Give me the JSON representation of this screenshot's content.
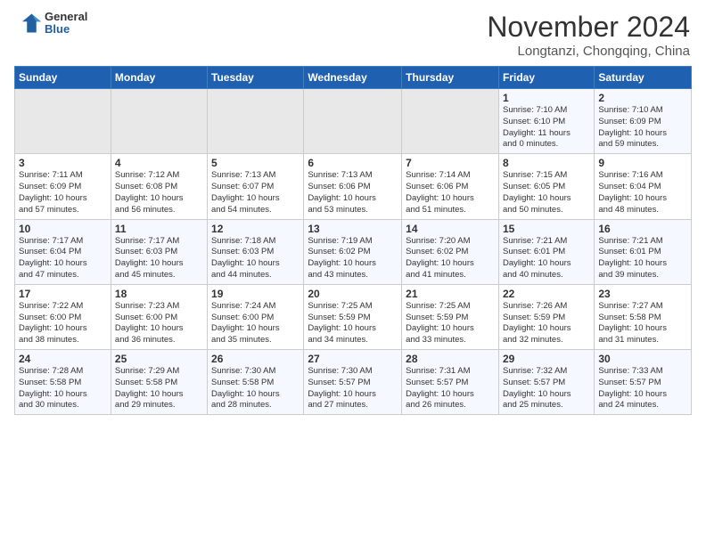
{
  "header": {
    "logo": {
      "general": "General",
      "blue": "Blue"
    },
    "title": "November 2024",
    "location": "Longtanzi, Chongqing, China"
  },
  "calendar": {
    "days_of_week": [
      "Sunday",
      "Monday",
      "Tuesday",
      "Wednesday",
      "Thursday",
      "Friday",
      "Saturday"
    ],
    "weeks": [
      [
        {
          "day": "",
          "info": ""
        },
        {
          "day": "",
          "info": ""
        },
        {
          "day": "",
          "info": ""
        },
        {
          "day": "",
          "info": ""
        },
        {
          "day": "",
          "info": ""
        },
        {
          "day": "1",
          "info": "Sunrise: 7:10 AM\nSunset: 6:10 PM\nDaylight: 11 hours\nand 0 minutes."
        },
        {
          "day": "2",
          "info": "Sunrise: 7:10 AM\nSunset: 6:09 PM\nDaylight: 10 hours\nand 59 minutes."
        }
      ],
      [
        {
          "day": "3",
          "info": "Sunrise: 7:11 AM\nSunset: 6:09 PM\nDaylight: 10 hours\nand 57 minutes."
        },
        {
          "day": "4",
          "info": "Sunrise: 7:12 AM\nSunset: 6:08 PM\nDaylight: 10 hours\nand 56 minutes."
        },
        {
          "day": "5",
          "info": "Sunrise: 7:13 AM\nSunset: 6:07 PM\nDaylight: 10 hours\nand 54 minutes."
        },
        {
          "day": "6",
          "info": "Sunrise: 7:13 AM\nSunset: 6:06 PM\nDaylight: 10 hours\nand 53 minutes."
        },
        {
          "day": "7",
          "info": "Sunrise: 7:14 AM\nSunset: 6:06 PM\nDaylight: 10 hours\nand 51 minutes."
        },
        {
          "day": "8",
          "info": "Sunrise: 7:15 AM\nSunset: 6:05 PM\nDaylight: 10 hours\nand 50 minutes."
        },
        {
          "day": "9",
          "info": "Sunrise: 7:16 AM\nSunset: 6:04 PM\nDaylight: 10 hours\nand 48 minutes."
        }
      ],
      [
        {
          "day": "10",
          "info": "Sunrise: 7:17 AM\nSunset: 6:04 PM\nDaylight: 10 hours\nand 47 minutes."
        },
        {
          "day": "11",
          "info": "Sunrise: 7:17 AM\nSunset: 6:03 PM\nDaylight: 10 hours\nand 45 minutes."
        },
        {
          "day": "12",
          "info": "Sunrise: 7:18 AM\nSunset: 6:03 PM\nDaylight: 10 hours\nand 44 minutes."
        },
        {
          "day": "13",
          "info": "Sunrise: 7:19 AM\nSunset: 6:02 PM\nDaylight: 10 hours\nand 43 minutes."
        },
        {
          "day": "14",
          "info": "Sunrise: 7:20 AM\nSunset: 6:02 PM\nDaylight: 10 hours\nand 41 minutes."
        },
        {
          "day": "15",
          "info": "Sunrise: 7:21 AM\nSunset: 6:01 PM\nDaylight: 10 hours\nand 40 minutes."
        },
        {
          "day": "16",
          "info": "Sunrise: 7:21 AM\nSunset: 6:01 PM\nDaylight: 10 hours\nand 39 minutes."
        }
      ],
      [
        {
          "day": "17",
          "info": "Sunrise: 7:22 AM\nSunset: 6:00 PM\nDaylight: 10 hours\nand 38 minutes."
        },
        {
          "day": "18",
          "info": "Sunrise: 7:23 AM\nSunset: 6:00 PM\nDaylight: 10 hours\nand 36 minutes."
        },
        {
          "day": "19",
          "info": "Sunrise: 7:24 AM\nSunset: 6:00 PM\nDaylight: 10 hours\nand 35 minutes."
        },
        {
          "day": "20",
          "info": "Sunrise: 7:25 AM\nSunset: 5:59 PM\nDaylight: 10 hours\nand 34 minutes."
        },
        {
          "day": "21",
          "info": "Sunrise: 7:25 AM\nSunset: 5:59 PM\nDaylight: 10 hours\nand 33 minutes."
        },
        {
          "day": "22",
          "info": "Sunrise: 7:26 AM\nSunset: 5:59 PM\nDaylight: 10 hours\nand 32 minutes."
        },
        {
          "day": "23",
          "info": "Sunrise: 7:27 AM\nSunset: 5:58 PM\nDaylight: 10 hours\nand 31 minutes."
        }
      ],
      [
        {
          "day": "24",
          "info": "Sunrise: 7:28 AM\nSunset: 5:58 PM\nDaylight: 10 hours\nand 30 minutes."
        },
        {
          "day": "25",
          "info": "Sunrise: 7:29 AM\nSunset: 5:58 PM\nDaylight: 10 hours\nand 29 minutes."
        },
        {
          "day": "26",
          "info": "Sunrise: 7:30 AM\nSunset: 5:58 PM\nDaylight: 10 hours\nand 28 minutes."
        },
        {
          "day": "27",
          "info": "Sunrise: 7:30 AM\nSunset: 5:57 PM\nDaylight: 10 hours\nand 27 minutes."
        },
        {
          "day": "28",
          "info": "Sunrise: 7:31 AM\nSunset: 5:57 PM\nDaylight: 10 hours\nand 26 minutes."
        },
        {
          "day": "29",
          "info": "Sunrise: 7:32 AM\nSunset: 5:57 PM\nDaylight: 10 hours\nand 25 minutes."
        },
        {
          "day": "30",
          "info": "Sunrise: 7:33 AM\nSunset: 5:57 PM\nDaylight: 10 hours\nand 24 minutes."
        }
      ]
    ]
  }
}
